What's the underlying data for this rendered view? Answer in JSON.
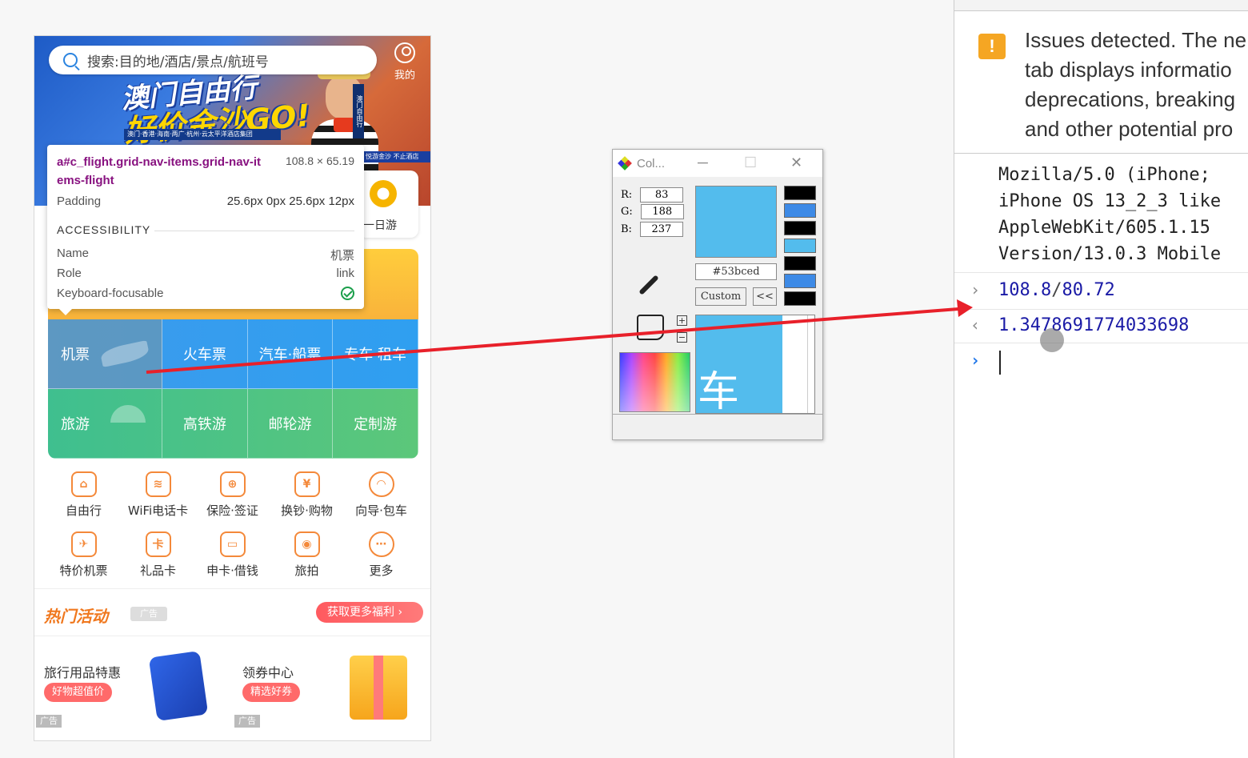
{
  "phone": {
    "search_placeholder": "搜索:目的地/酒店/景点/航班号",
    "mine_label": "我的",
    "banner": {
      "title": "澳门自由行",
      "subtitle": "好价金沙GO!",
      "strip_text": "澳门·香港·海南·两广·杭州·云太平洋酒店集团",
      "vertical_text": "澳门自由行",
      "tag_text": "悦游金沙 不止酒店"
    },
    "right_card_label": "一日游",
    "grid_row1": [
      "机票",
      "火车票",
      "汽车·船票",
      "专车·租车"
    ],
    "grid_row2": [
      "旅游",
      "高铁游",
      "邮轮游",
      "定制游"
    ],
    "icon_row1": [
      {
        "label": "自由行",
        "icon": "backpack-icon",
        "glyph": "⌂"
      },
      {
        "label": "WiFi电话卡",
        "icon": "wifi-card-icon",
        "glyph": "≋"
      },
      {
        "label": "保险·签证",
        "icon": "shield-icon",
        "glyph": "⊕"
      },
      {
        "label": "换钞·购物",
        "icon": "shopping-bag-icon",
        "glyph": "¥"
      },
      {
        "label": "向导·包车",
        "icon": "guide-icon",
        "glyph": "◠"
      }
    ],
    "icon_row2": [
      {
        "label": "特价机票",
        "icon": "plane-icon",
        "glyph": "✈"
      },
      {
        "label": "礼品卡",
        "icon": "gift-card-icon",
        "glyph": "卡"
      },
      {
        "label": "申卡·借钱",
        "icon": "credit-card-icon",
        "glyph": "▭"
      },
      {
        "label": "旅拍",
        "icon": "camera-icon",
        "glyph": "◉"
      },
      {
        "label": "更多",
        "icon": "more-icon",
        "glyph": "⋯"
      }
    ],
    "hot_title": "热门活动",
    "hot_ad_label": "广告",
    "hot_more": "获取更多福利 ›",
    "promo": [
      {
        "title": "旅行用品特惠",
        "pill": "好物超值价",
        "ad": "广告"
      },
      {
        "title": "领券中心",
        "pill": "精选好券",
        "ad": "广告"
      }
    ]
  },
  "tooltip": {
    "selector": "a#c_flight.grid-nav-items.grid-nav-items-flight",
    "dimensions": "108.8 × 65.19",
    "padding_label": "Padding",
    "padding_value": "25.6px 0px 25.6px 12px",
    "accessibility_label": "ACCESSIBILITY",
    "name_label": "Name",
    "name_value": "机票",
    "role_label": "Role",
    "role_value": "link",
    "keyboard_label": "Keyboard-focusable"
  },
  "color_picker": {
    "title": "Col...",
    "r_label": "R:",
    "g_label": "G:",
    "b_label": "B:",
    "r": "83",
    "g": "188",
    "b": "237",
    "hex": "#53bced",
    "custom_button": "Custom",
    "collapse_button": "<<",
    "zoom_glyph": "车",
    "colors": {
      "picked": "#53bced"
    }
  },
  "devtools": {
    "issue_lines": [
      "Issues detected. The ne",
      "tab displays informatio",
      "deprecations, breaking",
      "and other potential pro"
    ],
    "ua_lines": [
      "Mozilla/5.0 (iPhone;",
      "iPhone OS 13_2_3 like",
      "AppleWebKit/605.1.15",
      "Version/13.0.3 Mobile"
    ],
    "input_num": "108.8",
    "input_slash": "/",
    "input_den": "80.72",
    "output": "1.3478691774033698"
  }
}
